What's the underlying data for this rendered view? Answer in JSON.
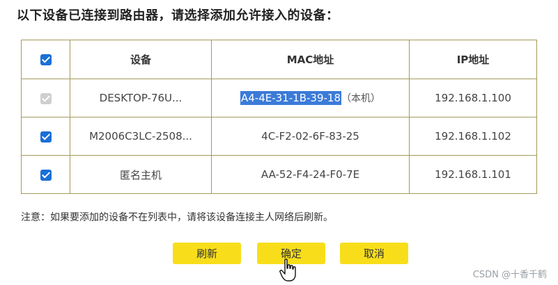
{
  "heading": "以下设备已连接到路由器，请选择添加允许接入的设备：",
  "table": {
    "headers": {
      "device": "设备",
      "mac": "MAC地址",
      "ip": "IP地址"
    },
    "rows": [
      {
        "checked": true,
        "disabled": true,
        "device": "DESKTOP-76U...",
        "mac": "A4-4E-31-1B-39-18",
        "mac_note": "（本机）",
        "ip": "192.168.1.100"
      },
      {
        "checked": true,
        "disabled": false,
        "device": "M2006C3LC-2508...",
        "mac": "4C-F2-02-6F-83-25",
        "mac_note": "",
        "ip": "192.168.1.102"
      },
      {
        "checked": true,
        "disabled": false,
        "device": "匿名主机",
        "mac": "AA-52-F4-24-F0-7E",
        "mac_note": "",
        "ip": "192.168.1.101"
      }
    ]
  },
  "note": "注意：如果要添加的设备不在列表中，请将该设备连接主人网络后刷新。",
  "buttons": {
    "refresh": "刷新",
    "ok": "确定",
    "cancel": "取消"
  },
  "watermark": "CSDN @十香千鹤",
  "icons": {
    "checkbox": "checkbox-checked-icon",
    "cursor": "hand-pointer-icon"
  },
  "colors": {
    "accent": "#1a6fd6",
    "button": "#f8de1a",
    "border": "#a39a5c",
    "selection": "#3b7bd8"
  }
}
